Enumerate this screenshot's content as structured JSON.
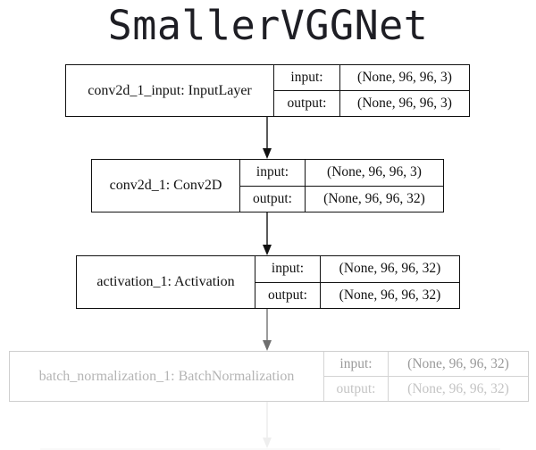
{
  "title": "SmallerVGGNet",
  "nodes": [
    {
      "name": "conv2d_1_input: InputLayer",
      "input_label": "input:",
      "input": "(None, 96, 96, 3)",
      "output_label": "output:",
      "output": "(None, 96, 96, 3)"
    },
    {
      "name": "conv2d_1: Conv2D",
      "input_label": "input:",
      "input": "(None, 96, 96, 3)",
      "output_label": "output:",
      "output": "(None, 96, 96, 32)"
    },
    {
      "name": "activation_1: Activation",
      "input_label": "input:",
      "input": "(None, 96, 96, 32)",
      "output_label": "output:",
      "output": "(None, 96, 96, 32)"
    },
    {
      "name": "batch_normalization_1: BatchNormalization",
      "input_label": "input:",
      "input": "(None, 96, 96, 32)",
      "output_label": "output:",
      "output": "(None, 96, 96, 32)"
    }
  ],
  "colors": {
    "stroke": "#111111",
    "faded_stroke": "#cfcfcf",
    "arrow": "#222222",
    "faded_arrow": "#7a7a7a"
  }
}
